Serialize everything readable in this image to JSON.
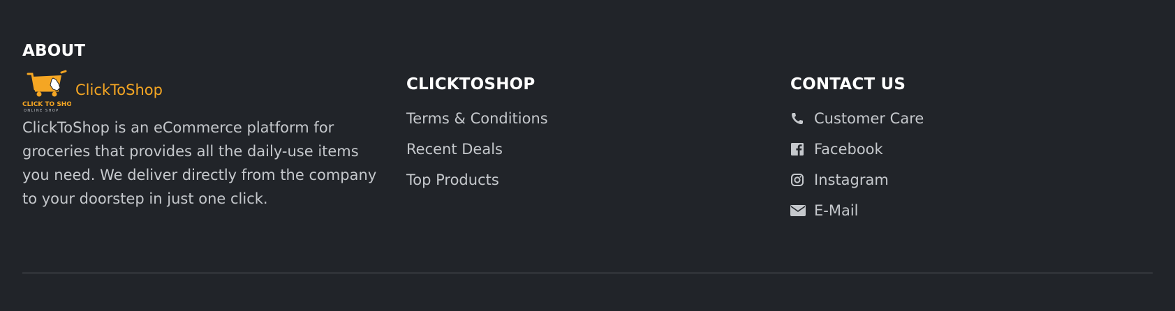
{
  "about": {
    "heading": "ABOUT",
    "brand_name": "ClickToShop",
    "logo_text_main": "CLICK TO SHOP",
    "logo_text_sub": "ONLINE SHOP",
    "description": "ClickToShop is an eCommerce platform for groceries that provides all the daily-use items you need. We deliver directly from the company to your doorstep in just one click."
  },
  "links": {
    "heading": "CLICKTOSHOP",
    "items": [
      {
        "label": "Terms & Conditions"
      },
      {
        "label": "Recent Deals"
      },
      {
        "label": "Top Products"
      }
    ]
  },
  "contact": {
    "heading": "CONTACT US",
    "items": [
      {
        "label": "Customer Care",
        "icon": "phone-icon"
      },
      {
        "label": "Facebook",
        "icon": "facebook-icon"
      },
      {
        "label": "Instagram",
        "icon": "instagram-icon"
      },
      {
        "label": "E-Mail",
        "icon": "envelope-icon"
      }
    ]
  },
  "colors": {
    "background": "#212429",
    "heading": "#ffffff",
    "text": "#c5c8cc",
    "brand": "#f5a623",
    "divider": "#5a5e63"
  }
}
